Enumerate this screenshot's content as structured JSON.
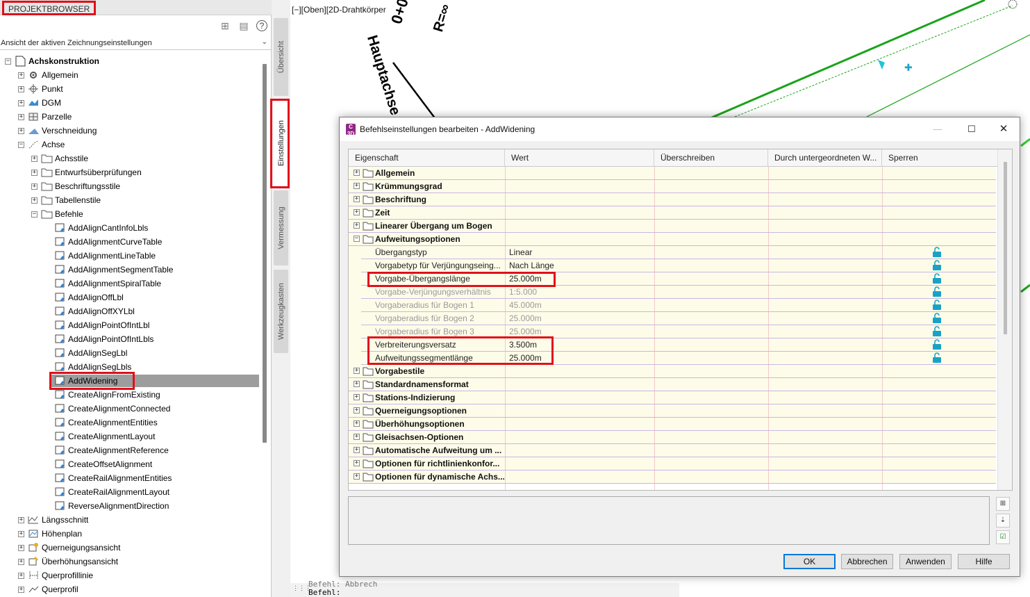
{
  "palette": {
    "title": "PROJEKTBROWSER",
    "view_selector": "Ansicht der aktiven Zeichnungseinstellungen",
    "tree": {
      "root": "Achskonstruktion",
      "level1": [
        "Allgemein",
        "Punkt",
        "DGM",
        "Parzelle",
        "Verschneidung",
        "Achse"
      ],
      "achse_children": [
        "Achsstile",
        "Entwurfsüberprüfungen",
        "Beschriftungsstile",
        "Tabellenstile",
        "Befehle"
      ],
      "befehle": [
        "AddAlignCantInfoLbls",
        "AddAlignmentCurveTable",
        "AddAlignmentLineTable",
        "AddAlignmentSegmentTable",
        "AddAlignmentSpiralTable",
        "AddAlignOffLbl",
        "AddAlignOffXYLbl",
        "AddAlignPointOfIntLbl",
        "AddAlignPointOfIntLbls",
        "AddAlignSegLbl",
        "AddAlignSegLbls",
        "AddWidening",
        "CreateAlignFromExisting",
        "CreateAlignmentConnected",
        "CreateAlignmentEntities",
        "CreateAlignmentLayout",
        "CreateAlignmentReference",
        "CreateOffsetAlignment",
        "CreateRailAlignmentEntities",
        "CreateRailAlignmentLayout",
        "ReverseAlignmentDirection"
      ],
      "level1_after": [
        "Längsschnitt",
        "Höhenplan",
        "Querneigungsansicht",
        "Überhöhungsansicht",
        "Querprofillinie",
        "Querprofil"
      ],
      "selected": "AddWidening"
    }
  },
  "side_tabs": [
    "Übersicht",
    "Einstellungen",
    "Vermessung",
    "Werkzeugkasten"
  ],
  "drawing": {
    "view_label": "[−][Oben][2D-Drahtkörper",
    "text_hauptachse": "Hauptachse",
    "text_radius": "R=∞",
    "text_station": "0+0",
    "command_line_top": "Befehl:  Abbrech",
    "command_line": "Befehl:"
  },
  "dialog": {
    "title": "Befehlseinstellungen bearbeiten - AddWidening",
    "app_icon_text": "C 3D",
    "columns": [
      "Eigenschaft",
      "Wert",
      "Überschreiben",
      "Durch untergeordneten W...",
      "Sperren"
    ],
    "rows": [
      {
        "kind": "cat",
        "expander": "+",
        "name": "Allgemein",
        "value": ""
      },
      {
        "kind": "cat",
        "expander": "+",
        "name": "Krümmungsgrad",
        "value": ""
      },
      {
        "kind": "cat",
        "expander": "+",
        "name": "Beschriftung",
        "value": ""
      },
      {
        "kind": "cat",
        "expander": "+",
        "name": "Zeit",
        "value": ""
      },
      {
        "kind": "cat",
        "expander": "+",
        "name": "Linearer Übergang um Bogen",
        "value": ""
      },
      {
        "kind": "cat",
        "expander": "−",
        "name": "Aufweitungsoptionen",
        "value": ""
      },
      {
        "kind": "sub",
        "name": "Übergangstyp",
        "value": "Linear"
      },
      {
        "kind": "sub",
        "name": "Vorgabetyp für Verjüngungseing...",
        "value": "Nach Länge"
      },
      {
        "kind": "sub",
        "name": "Vorgabe-Übergangslänge",
        "value": "25.000m"
      },
      {
        "kind": "sub",
        "disabled": true,
        "name": "Vorgabe-Verjüngungsverhältnis",
        "value": "1:5.000"
      },
      {
        "kind": "sub",
        "disabled": true,
        "name": "Vorgaberadius für Bogen 1",
        "value": "45.000m"
      },
      {
        "kind": "sub",
        "disabled": true,
        "name": "Vorgaberadius für Bogen 2",
        "value": "25.000m"
      },
      {
        "kind": "sub",
        "disabled": true,
        "name": "Vorgaberadius für Bogen 3",
        "value": "25.000m"
      },
      {
        "kind": "sub",
        "name": "Verbreiterungsversatz",
        "value": "3.500m"
      },
      {
        "kind": "sub",
        "name": "Aufweitungssegmentlänge",
        "value": "25.000m"
      },
      {
        "kind": "cat",
        "expander": "+",
        "name": "Vorgabestile",
        "value": ""
      },
      {
        "kind": "cat",
        "expander": "+",
        "name": "Standardnamensformat",
        "value": ""
      },
      {
        "kind": "cat",
        "expander": "+",
        "name": "Stations-Indizierung",
        "value": ""
      },
      {
        "kind": "cat",
        "expander": "+",
        "name": "Querneigungsoptionen",
        "value": ""
      },
      {
        "kind": "cat",
        "expander": "+",
        "name": "Überhöhungsoptionen",
        "value": ""
      },
      {
        "kind": "cat",
        "expander": "+",
        "name": "Gleisachsen-Optionen",
        "value": ""
      },
      {
        "kind": "cat",
        "expander": "+",
        "name": "Automatische Aufweitung um ...",
        "value": ""
      },
      {
        "kind": "cat",
        "expander": "+",
        "name": "Optionen für richtlinienkonfor...",
        "value": ""
      },
      {
        "kind": "cat",
        "expander": "+",
        "name": "Optionen für dynamische Achs...",
        "value": ""
      }
    ],
    "buttons": {
      "ok": "OK",
      "cancel": "Abbrechen",
      "apply": "Anwenden",
      "help": "Hilfe"
    },
    "colors": {
      "highlight": "#e0101a",
      "row_bg": "#fdfce9",
      "selection": "#9d9d9d"
    }
  }
}
